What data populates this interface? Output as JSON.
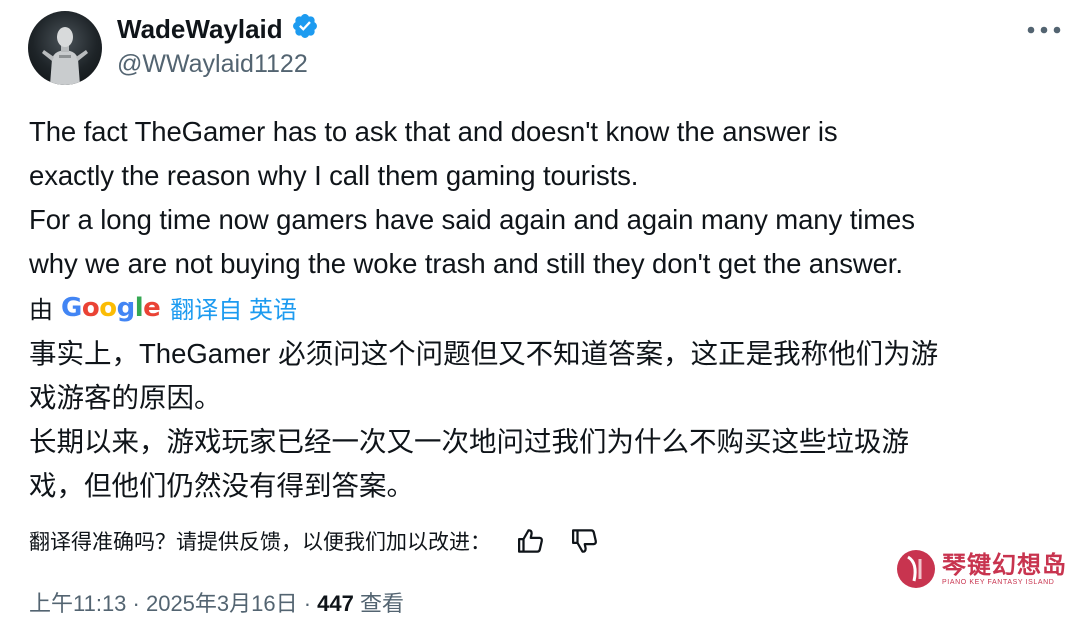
{
  "author": {
    "display_name": "WadeWaylaid",
    "handle": "@WWaylaid1122",
    "verified": true,
    "verified_color": "#1d9bf0"
  },
  "tweet": {
    "lines": [
      "The fact TheGamer has to ask that and doesn't know the answer is",
      "exactly the reason why I call them gaming tourists.",
      "For a long time now gamers have said again and again many many times",
      "why we are not buying the woke trash and still they don't get the answer."
    ]
  },
  "translation_bar": {
    "by": "由",
    "provider": [
      "G",
      "o",
      "o",
      "g",
      "l",
      "e"
    ],
    "provider_colors": [
      "#4285f4",
      "#ea4335",
      "#fbbc05",
      "#4285f4",
      "#34a853",
      "#ea4335"
    ],
    "translated_from": "翻译自 英语"
  },
  "translation": {
    "lines": [
      "事实上，TheGamer 必须问这个问题但又不知道答案，这正是我称他们为游",
      "戏游客的原因。",
      "长期以来，游戏玩家已经一次又一次地问过我们为什么不购买这些垃圾游",
      "戏，但他们仍然没有得到答案。"
    ]
  },
  "feedback": {
    "prompt": "翻译得准确吗？请提供反馈，以便我们加以改进：",
    "icons": [
      "thumbs-up-icon",
      "thumbs-down-icon"
    ]
  },
  "meta": {
    "time_date": "上午11:13 · 2025年3月16日 · ",
    "views_count": "447",
    "views_label": " 查看"
  },
  "watermark": {
    "main": "琴键幻想岛",
    "sub": "PIANO KEY FANTASY ISLAND",
    "color": "#c8344f"
  }
}
